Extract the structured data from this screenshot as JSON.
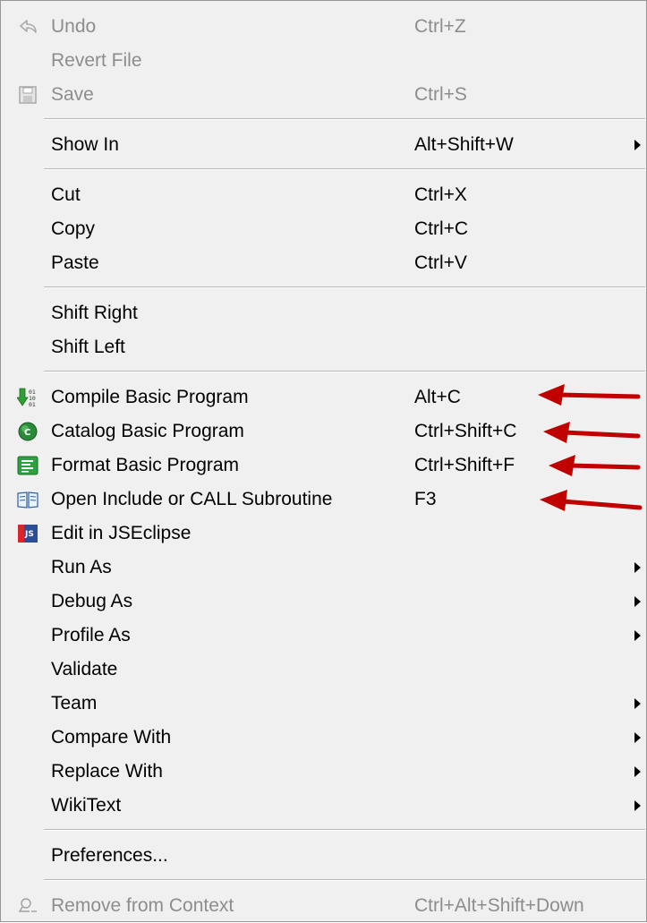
{
  "menu": {
    "undo": {
      "label": "Undo",
      "shortcut": "Ctrl+Z"
    },
    "revert_file": {
      "label": "Revert File"
    },
    "save": {
      "label": "Save",
      "shortcut": "Ctrl+S"
    },
    "show_in": {
      "label": "Show In",
      "shortcut": "Alt+Shift+W"
    },
    "cut": {
      "label": "Cut",
      "shortcut": "Ctrl+X"
    },
    "copy": {
      "label": "Copy",
      "shortcut": "Ctrl+C"
    },
    "paste": {
      "label": "Paste",
      "shortcut": "Ctrl+V"
    },
    "shift_right": {
      "label": "Shift Right"
    },
    "shift_left": {
      "label": "Shift Left"
    },
    "compile": {
      "label": "Compile Basic Program",
      "shortcut": "Alt+C"
    },
    "catalog": {
      "label": "Catalog Basic Program",
      "shortcut": "Ctrl+Shift+C"
    },
    "format": {
      "label": "Format Basic Program",
      "shortcut": "Ctrl+Shift+F"
    },
    "open_include": {
      "label": "Open Include or CALL Subroutine",
      "shortcut": "F3"
    },
    "edit_jseclipse": {
      "label": "Edit in JSEclipse",
      "icon_text": "JS"
    },
    "run_as": {
      "label": "Run As"
    },
    "debug_as": {
      "label": "Debug As"
    },
    "profile_as": {
      "label": "Profile As"
    },
    "validate": {
      "label": "Validate"
    },
    "team": {
      "label": "Team"
    },
    "compare_with": {
      "label": "Compare With"
    },
    "replace_with": {
      "label": "Replace With"
    },
    "wikitext": {
      "label": "WikiText"
    },
    "preferences": {
      "label": "Preferences..."
    },
    "remove_context": {
      "label": "Remove from Context",
      "shortcut": "Ctrl+Alt+Shift+Down"
    }
  },
  "icons": {
    "undo": "undo-arrow-icon",
    "save": "floppy-disk-icon",
    "compile": "compile-binary-icon",
    "catalog": "catalog-globe-icon",
    "format": "format-list-icon",
    "open_include": "open-book-icon",
    "edit_jseclipse": "jseclipse-icon",
    "remove_context": "remove-context-icon"
  },
  "colors": {
    "menu_background": "#f0f0f0",
    "disabled_text": "#8d8d8d",
    "annotation_arrow": "#c00000"
  }
}
